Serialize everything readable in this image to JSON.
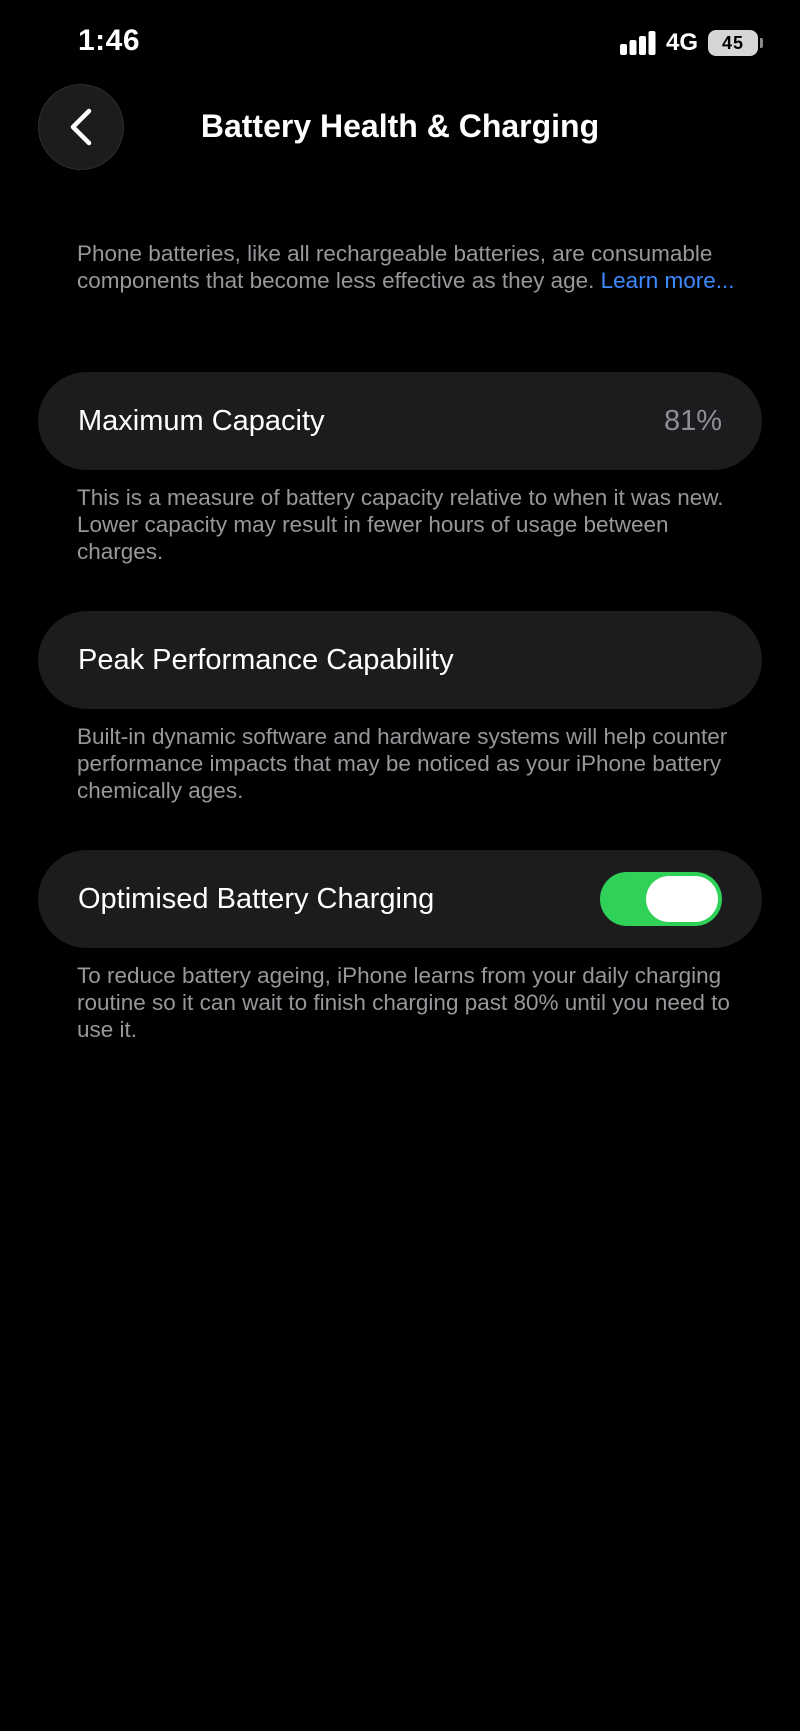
{
  "status_bar": {
    "time": "1:46",
    "network": "4G",
    "battery_level": "45",
    "icons": [
      "signal-bars-icon",
      "battery-icon"
    ]
  },
  "nav": {
    "title": "Battery Health & Charging",
    "back_icon": "chevron-left-icon"
  },
  "intro": {
    "text": "Phone batteries, like all rechargeable batteries, are consumable components that become less effective as they age.",
    "link_label": "Learn more..."
  },
  "max_capacity": {
    "label": "Maximum Capacity",
    "value": "81%",
    "description": "This is a measure of battery capacity relative to when it was new. Lower capacity may result in fewer hours of usage between charges."
  },
  "peak_performance": {
    "label": "Peak Performance Capability",
    "description": "Built-in dynamic software and hardware systems will help counter performance impacts that may be noticed as your iPhone battery chemically ages."
  },
  "optimised_charging": {
    "label": "Optimised Battery Charging",
    "enabled": true,
    "description": "To reduce battery ageing, iPhone learns from your daily charging routine so it can wait to finish charging past 80% until you need to use it."
  },
  "colors": {
    "background": "#000000",
    "cell_background": "#1c1c1e",
    "link": "#3d8bff",
    "toggle_on": "#30d158",
    "secondary_text": "#97979c"
  }
}
